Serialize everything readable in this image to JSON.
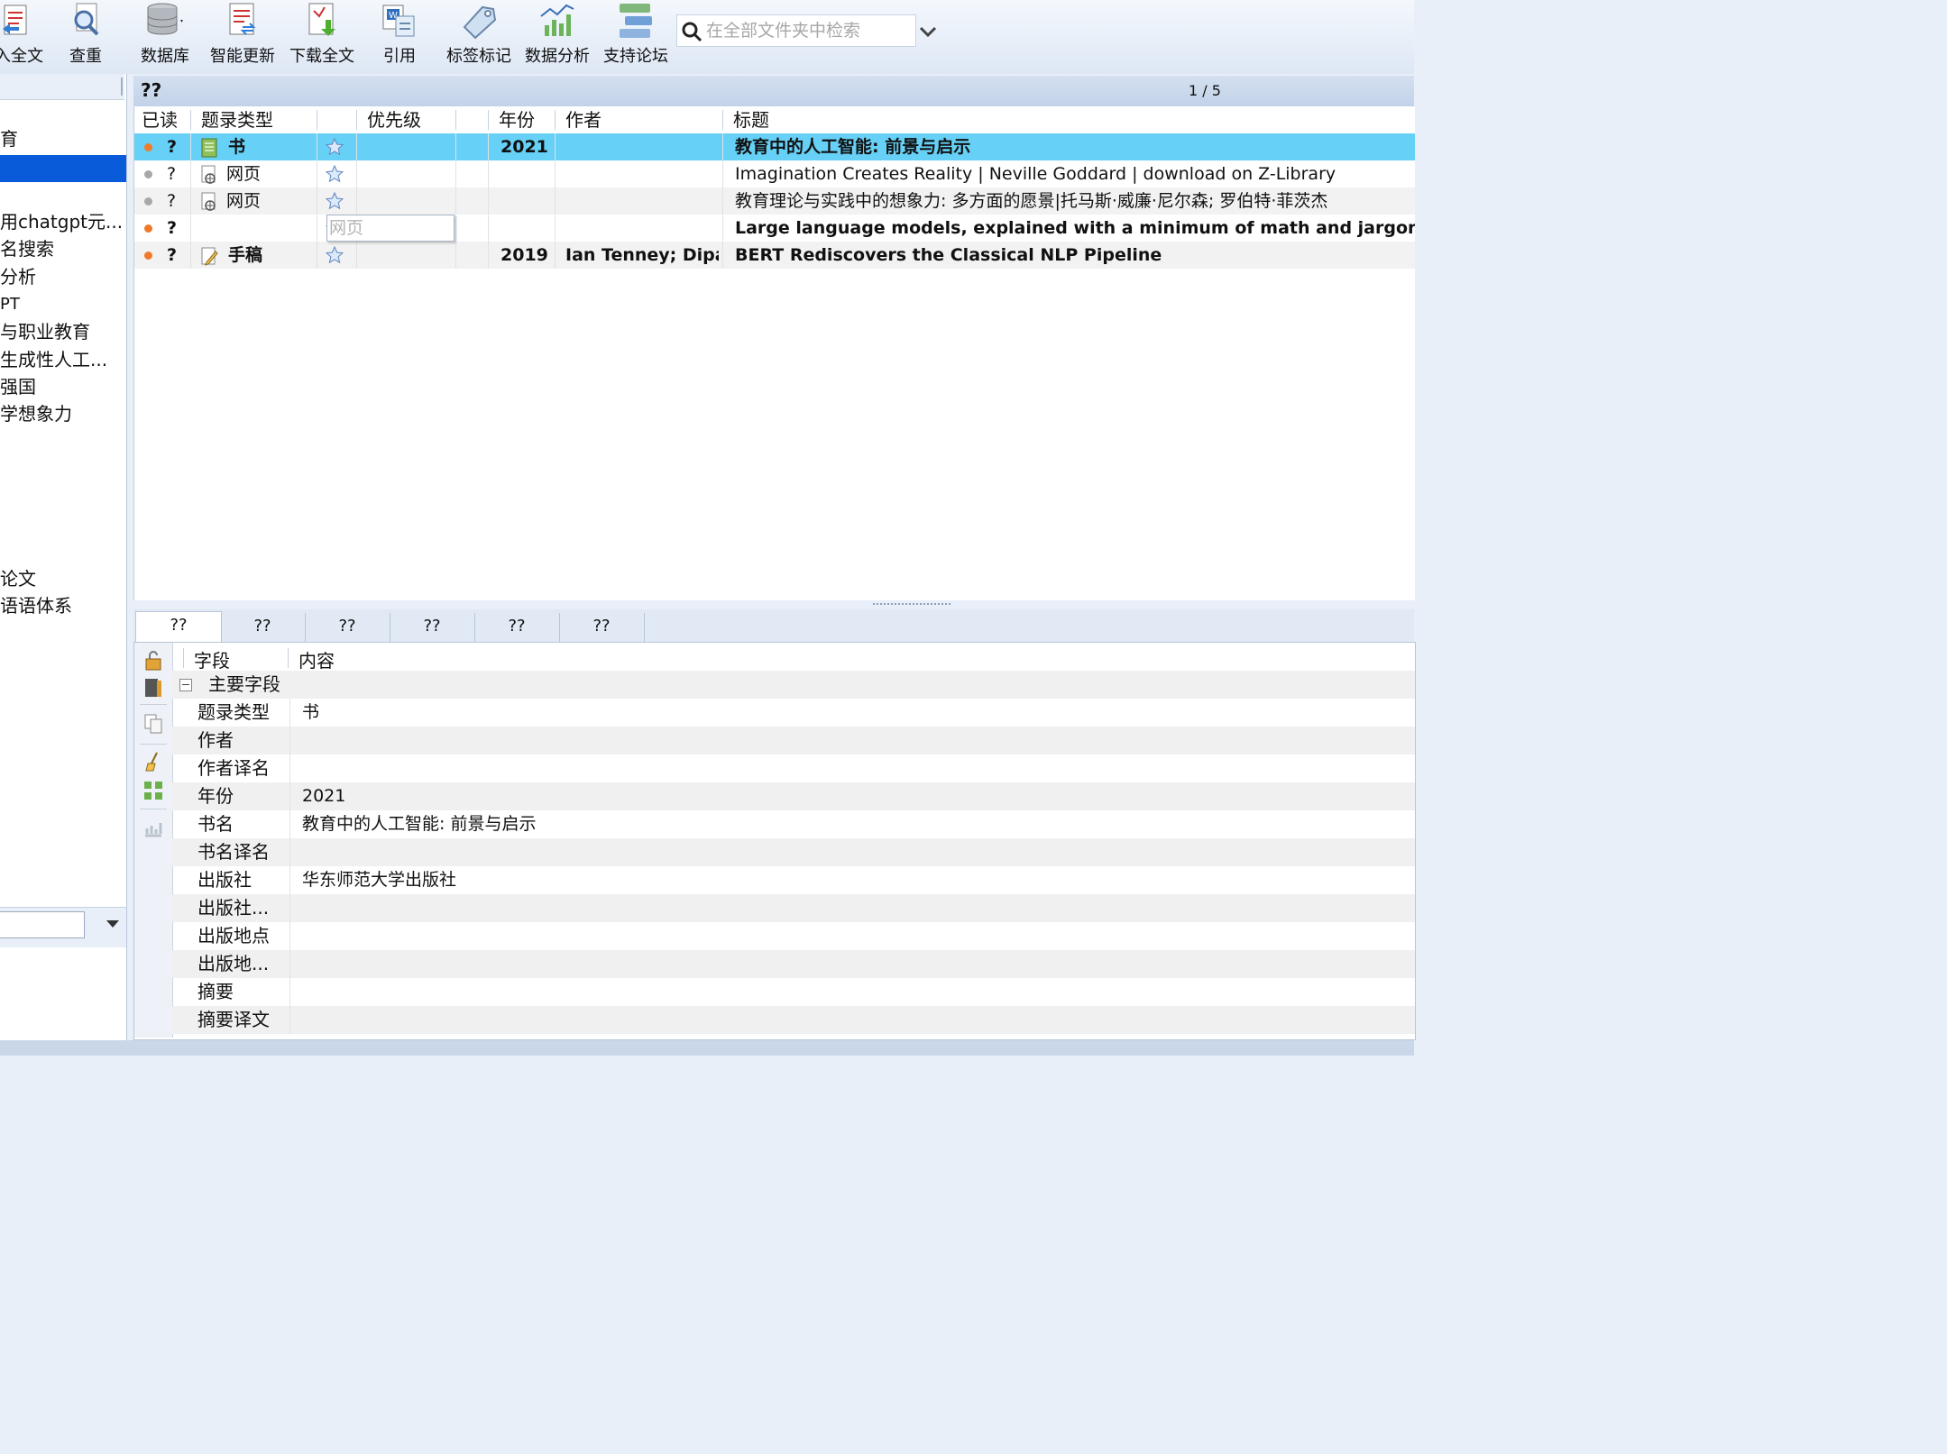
{
  "toolbar": {
    "buttons": [
      {
        "label": "入全文",
        "icon": "fulltext-import-icon"
      },
      {
        "label": "查重",
        "icon": "duplicate-search-icon"
      },
      {
        "label": "数据库",
        "icon": "database-icon"
      },
      {
        "label": "智能更新",
        "icon": "smart-update-icon"
      },
      {
        "label": "下载全文",
        "icon": "download-pdf-icon"
      },
      {
        "label": "引用",
        "icon": "cite-word-icon"
      },
      {
        "label": "标签标记",
        "icon": "tag-icon"
      },
      {
        "label": "数据分析",
        "icon": "chart-analysis-icon"
      },
      {
        "label": "支持论坛",
        "icon": "forum-icon"
      }
    ],
    "search_placeholder": "在全部文件夹中检索"
  },
  "sidebar": {
    "items": [
      {
        "label": "育",
        "selected": false
      },
      {
        "label": "",
        "selected": true
      },
      {
        "label": "用chatgpt元...",
        "selected": false
      },
      {
        "label": "名搜索",
        "selected": false
      },
      {
        "label": "分析",
        "selected": false
      },
      {
        "label": "PT",
        "selected": false
      },
      {
        "label": "与职业教育",
        "selected": false
      },
      {
        "label": "生成性人工...",
        "selected": false
      },
      {
        "label": "强国",
        "selected": false
      },
      {
        "label": "学想象力",
        "selected": false
      },
      {
        "label": "论文",
        "selected": false
      },
      {
        "label": "语语体系",
        "selected": false
      }
    ]
  },
  "list": {
    "title": "??",
    "page": "1 / 5",
    "columns": {
      "read": "已读",
      "type": "题录类型",
      "priority": "优先级",
      "year": "年份",
      "author": "作者",
      "title": "标题"
    },
    "rows": [
      {
        "status": "orange",
        "q": "?",
        "type": "书",
        "type_icon": "book-icon",
        "year": "2021",
        "author": "",
        "title": "教育中的人工智能: 前景与启示",
        "bold": true,
        "selected": true
      },
      {
        "status": "gray",
        "q": "?",
        "type": "网页",
        "type_icon": "webpage-icon",
        "year": "",
        "author": "",
        "title": "Imagination Creates Reality | Neville Goddard | download on Z-Library",
        "bold": false,
        "selected": false
      },
      {
        "status": "gray",
        "q": "?",
        "type": "网页",
        "type_icon": "webpage-icon",
        "year": "",
        "author": "",
        "title": "教育理论与实践中的想象力: 多方面的愿景|托马斯·威廉·尼尔森; 罗伯特·菲茨杰",
        "bold": false,
        "selected": false
      },
      {
        "status": "orange",
        "q": "?",
        "type": "",
        "type_icon": "",
        "year": "",
        "author": "",
        "title": "Large language models, explained with a minimum of math and jargon",
        "bold": true,
        "selected": false
      },
      {
        "status": "orange",
        "q": "?",
        "type": "手稿",
        "type_icon": "manuscript-icon",
        "year": "2019",
        "author": "Ian Tenney; Dipa..",
        "title": "BERT Rediscovers the Classical NLP Pipeline",
        "bold": true,
        "selected": false
      }
    ],
    "tooltip": "网页"
  },
  "details": {
    "tabs": [
      "??",
      "??",
      "??",
      "??",
      "??",
      "??"
    ],
    "columns": {
      "field": "字段",
      "content": "内容"
    },
    "group": "主要字段",
    "fields": [
      {
        "field": "题录类型",
        "value": "书"
      },
      {
        "field": "作者",
        "value": ""
      },
      {
        "field": "作者译名",
        "value": ""
      },
      {
        "field": "年份",
        "value": "2021"
      },
      {
        "field": "书名",
        "value": "教育中的人工智能: 前景与启示"
      },
      {
        "field": "书名译名",
        "value": ""
      },
      {
        "field": "出版社",
        "value": "华东师范大学出版社"
      },
      {
        "field": "出版社...",
        "value": ""
      },
      {
        "field": "出版地点",
        "value": ""
      },
      {
        "field": "出版地...",
        "value": ""
      },
      {
        "field": "摘要",
        "value": ""
      },
      {
        "field": "摘要译文",
        "value": ""
      }
    ]
  },
  "colors": {
    "selection": "#66d0f6",
    "tree_selection": "#0a5bd9",
    "unread_dot": "#f07a2a",
    "read_dot": "#a8a8a8"
  }
}
